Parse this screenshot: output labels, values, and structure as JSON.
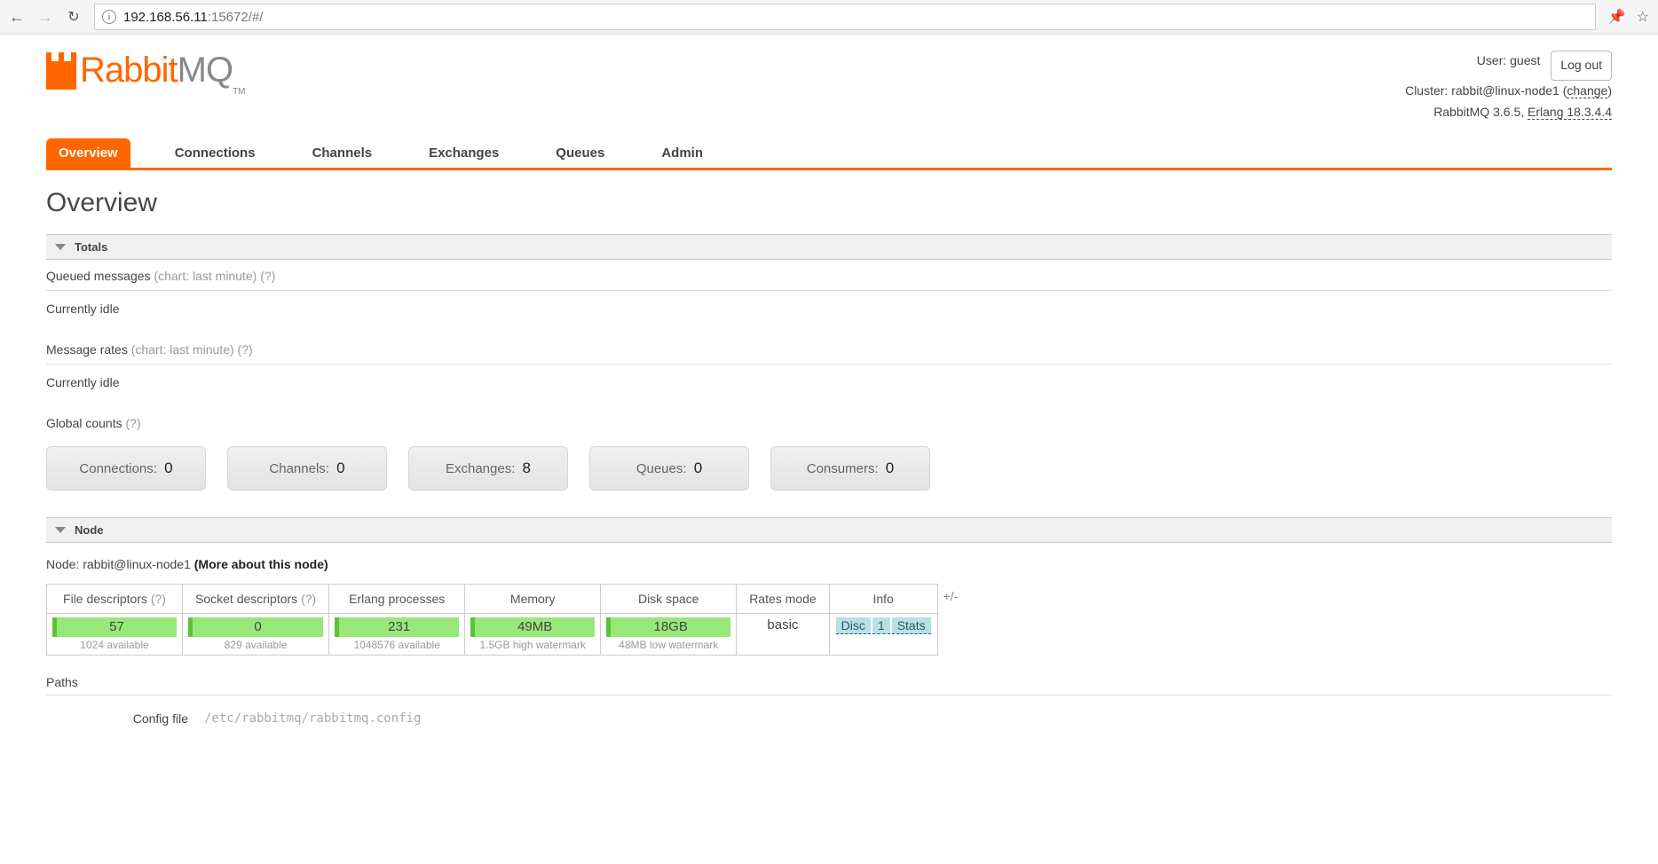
{
  "browser": {
    "url_host": "192.168.56.11",
    "url_path": ":15672/#/"
  },
  "header": {
    "user_label": "User: ",
    "user": "guest",
    "cluster_label": "Cluster: ",
    "cluster": "rabbit@linux-node1",
    "change_text": "change",
    "version_prefix": "RabbitMQ ",
    "version": "3.6.5",
    "erlang_prefix": ", ",
    "erlang": "Erlang 18.3.4.4",
    "logout": "Log out",
    "logo_rabbit": "Rabbit",
    "logo_mq": "MQ",
    "logo_tm": "TM"
  },
  "tabs": [
    "Overview",
    "Connections",
    "Channels",
    "Exchanges",
    "Queues",
    "Admin"
  ],
  "page_title": "Overview",
  "sections": {
    "totals": "Totals",
    "queued_label": "Queued messages",
    "chart_hint": "(chart: last minute)",
    "help": "(?)",
    "idle": "Currently idle",
    "rates_label": "Message rates",
    "global_counts": "Global counts"
  },
  "counts": [
    {
      "label": "Connections:",
      "value": "0"
    },
    {
      "label": "Channels:",
      "value": "0"
    },
    {
      "label": "Exchanges:",
      "value": "8"
    },
    {
      "label": "Queues:",
      "value": "0"
    },
    {
      "label": "Consumers:",
      "value": "0"
    }
  ],
  "node": {
    "section": "Node",
    "line_prefix": "Node: ",
    "name": "rabbit@linux-node1",
    "more": "(More about this node)",
    "cols": [
      "File descriptors",
      "Socket descriptors",
      "Erlang processes",
      "Memory",
      "Disk space",
      "Rates mode",
      "Info"
    ],
    "plusminus": "+/-",
    "cells": {
      "fd": {
        "value": "57",
        "sub": "1024 available"
      },
      "sd": {
        "value": "0",
        "sub": "829 available"
      },
      "ep": {
        "value": "231",
        "sub": "1048576 available"
      },
      "mem": {
        "value": "49MB",
        "sub": "1.5GB high watermark"
      },
      "disk": {
        "value": "18GB",
        "sub": "48MB low watermark"
      },
      "rates": "basic",
      "info": [
        "Disc",
        "1",
        "Stats"
      ]
    }
  },
  "paths": {
    "head": "Paths",
    "config_label": "Config file",
    "config_value": "/etc/rabbitmq/rabbitmq.config"
  }
}
